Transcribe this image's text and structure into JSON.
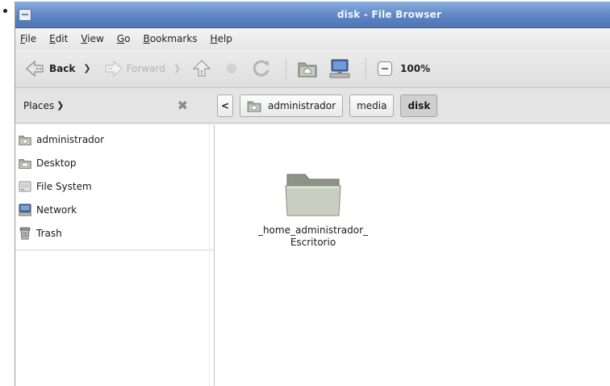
{
  "window": {
    "title": "disk - File Browser"
  },
  "menubar": {
    "items": [
      {
        "accel": "F",
        "rest": "ile"
      },
      {
        "accel": "E",
        "rest": "dit"
      },
      {
        "accel": "V",
        "rest": "iew"
      },
      {
        "accel": "G",
        "rest": "o"
      },
      {
        "accel": "B",
        "rest": "ookmarks"
      },
      {
        "accel": "H",
        "rest": "elp"
      }
    ]
  },
  "toolbar": {
    "back_label": "Back",
    "forward_label": "Forward",
    "zoom_level": "100%"
  },
  "places": {
    "header": "Places",
    "items": [
      {
        "label": "administrador",
        "icon": "home-folder-icon"
      },
      {
        "label": "Desktop",
        "icon": "desktop-folder-icon"
      },
      {
        "label": "File System",
        "icon": "filesystem-icon"
      },
      {
        "label": "Network",
        "icon": "network-icon"
      },
      {
        "label": "Trash",
        "icon": "trash-icon"
      }
    ]
  },
  "breadcrumb": {
    "back_arrow": "<",
    "items": [
      {
        "label": "administrador",
        "icon": "home-folder-icon",
        "active": false
      },
      {
        "label": "media",
        "active": false
      },
      {
        "label": "disk",
        "active": true
      }
    ]
  },
  "files": [
    {
      "name_line1": "_home_administrador_",
      "name_line2": "Escritorio",
      "icon": "folder-icon"
    }
  ],
  "colors": {
    "titlebar": "#5f86c4",
    "window_bg": "#ededed",
    "content_bg": "#ffffff"
  }
}
